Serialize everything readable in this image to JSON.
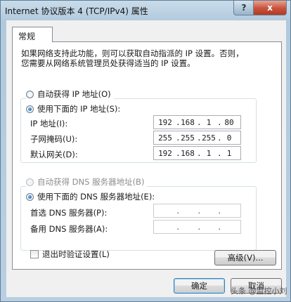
{
  "window": {
    "title": "Internet 协议版本 4 (TCP/IPv4) 属性",
    "help_label": "?",
    "close_label": "x"
  },
  "tabs": [
    {
      "label": "常规"
    }
  ],
  "description": {
    "line1": "如果网络支持此功能，则可以获取自动指派的 IP 设置。否则，",
    "line2": "您需要从网络系统管理员处获得适当的 IP 设置。"
  },
  "ip_mode": {
    "auto_label": "自动获得 IP 地址(O)",
    "manual_label": "使用下面的 IP 地址(S):",
    "selected": "manual"
  },
  "ip_fields": [
    {
      "label": "IP 地址(I):",
      "octets": [
        "192",
        "168",
        "1",
        "80"
      ]
    },
    {
      "label": "子网掩码(U):",
      "octets": [
        "255",
        "255",
        "255",
        "0"
      ]
    },
    {
      "label": "默认网关(D):",
      "octets": [
        "192",
        "168",
        "1",
        "1"
      ]
    }
  ],
  "dns_mode": {
    "auto_label": "自动获得 DNS 服务器地址(B)",
    "manual_label": "使用下面的 DNS 服务器地址(E):",
    "selected": "manual"
  },
  "dns_fields": [
    {
      "label": "首选 DNS 服务器(P):",
      "octets": [
        "",
        "",
        "",
        ""
      ]
    },
    {
      "label": "备用 DNS 服务器(A):",
      "octets": [
        "",
        "",
        "",
        ""
      ]
    }
  ],
  "validate_on_exit": {
    "label": "退出时验证设置(L)",
    "checked": false
  },
  "buttons": {
    "advanced": "高级(V)...",
    "ok": "确定",
    "cancel": "取消"
  },
  "watermark": "头条 @监控小刘"
}
